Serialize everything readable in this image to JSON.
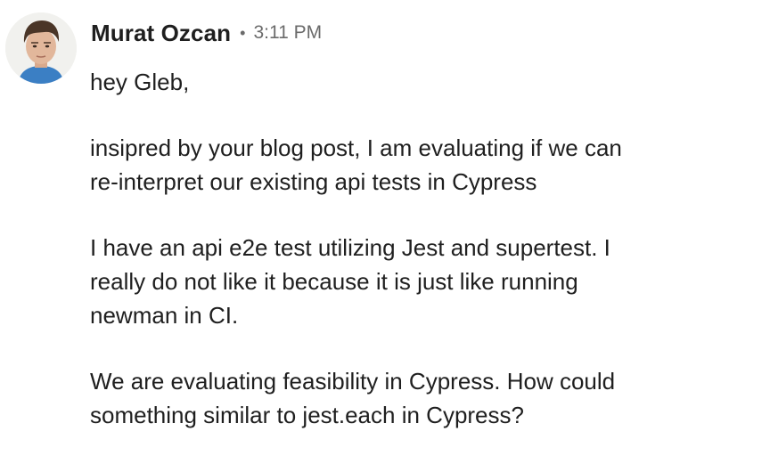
{
  "message": {
    "author": "Murat Ozcan",
    "separator": "•",
    "timestamp": "3:11 PM",
    "avatar_icon": "user-avatar-photo",
    "paragraphs": [
      {
        "lines": [
          "hey Gleb,"
        ]
      },
      {
        "lines": [
          "insipred by your blog post, I am evaluating if we can",
          "re-interpret our existing api tests in Cypress"
        ]
      },
      {
        "lines": [
          "I have an api e2e test utilizing Jest and supertest. I",
          "really do not like it because it is just like running",
          "newman in CI."
        ]
      },
      {
        "lines": [
          "We are evaluating feasibility in Cypress. How could",
          "something similar to jest.each in Cypress?"
        ]
      }
    ]
  }
}
